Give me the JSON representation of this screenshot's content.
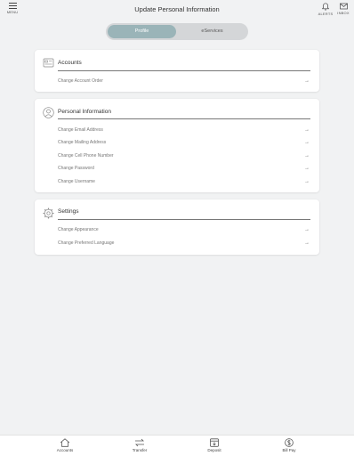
{
  "header": {
    "title": "Update Personal Information",
    "menu_label": "MENU",
    "alerts_label": "ALERTS",
    "inbox_label": "INBOX"
  },
  "segments": {
    "profile": "Profile",
    "eservices": "eServices"
  },
  "accounts": {
    "title": "Accounts",
    "items": [
      {
        "label": "Change Account Order"
      }
    ]
  },
  "personal": {
    "title": "Personal Information",
    "items": [
      {
        "label": "Change Email Address"
      },
      {
        "label": "Change Mailing Address"
      },
      {
        "label": "Change Cell Phone Number"
      },
      {
        "label": "Change Password"
      },
      {
        "label": "Change Username"
      }
    ]
  },
  "settings": {
    "title": "Settings",
    "items": [
      {
        "label": "Change Appearance"
      },
      {
        "label": "Change Preferred Language"
      }
    ]
  },
  "arrow": "→",
  "tabs": [
    {
      "label": "Accounts",
      "icon": "home-icon"
    },
    {
      "label": "Transfer",
      "icon": "transfer-icon"
    },
    {
      "label": "Deposit",
      "icon": "deposit-icon"
    },
    {
      "label": "Bill Pay",
      "icon": "bill-pay-icon"
    }
  ],
  "colors": {
    "background": "#f1f2f3",
    "accent": "#9ab4b8",
    "segment_track": "#d4d6d8"
  }
}
